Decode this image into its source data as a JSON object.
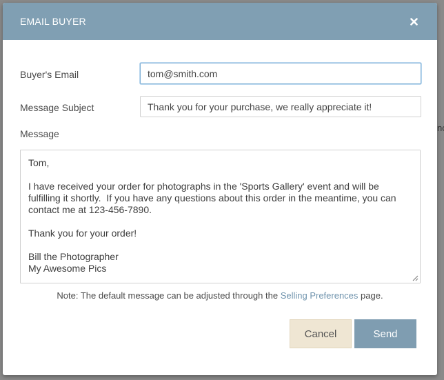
{
  "modal": {
    "title": "EMAIL BUYER",
    "close_icon": "close-icon"
  },
  "form": {
    "buyer_email_label": "Buyer's Email",
    "buyer_email_value": "tom@smith.com",
    "subject_label": "Message Subject",
    "subject_value": "Thank you for your purchase, we really appreciate it!",
    "message_label": "Message",
    "message_value": "Tom,\n\nI have received your order for photographs in the 'Sports Gallery' event and will be fulfilling it shortly.  If you have any questions about this order in the meantime, you can contact me at 123-456-7890.\n\nThank you for your order!\n\nBill the Photographer\nMy Awesome Pics"
  },
  "note": {
    "prefix": "Note: The default message can be adjusted through the ",
    "link": "Selling Preferences",
    "suffix": " page."
  },
  "buttons": {
    "cancel": "Cancel",
    "send": "Send"
  },
  "background": {
    "peek_text": "no"
  },
  "colors": {
    "header": "#809fb3",
    "send_button": "#7f9db1",
    "cancel_button": "#efe6d3",
    "link": "#6f93ad"
  }
}
